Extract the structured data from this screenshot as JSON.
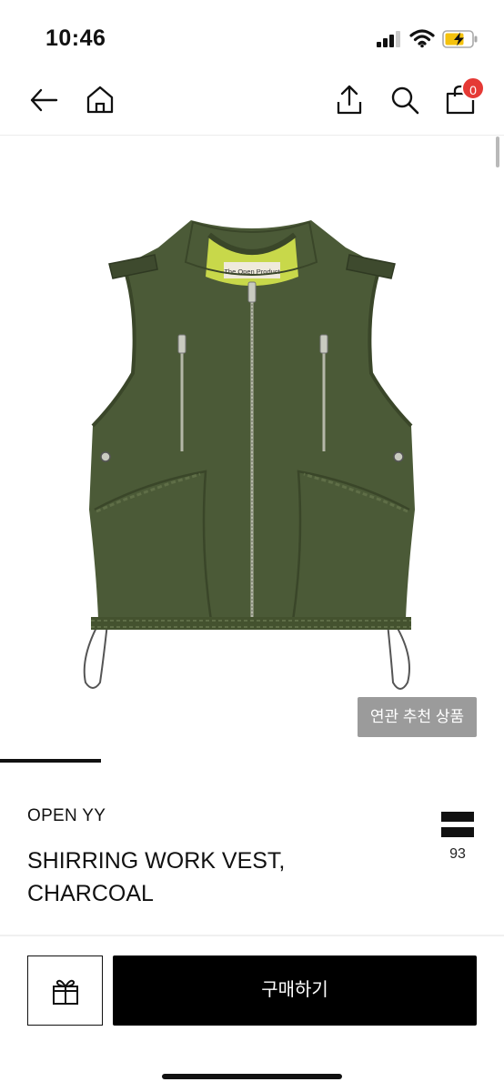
{
  "status_bar": {
    "time": "10:46"
  },
  "nav": {
    "cart_count": "0"
  },
  "product": {
    "image_label": "The Open Product",
    "related_label": "연관 추천 상품",
    "brand": "OPEN YY",
    "title": "SHIRRING WORK VEST, CHARCOAL",
    "size_count": "93"
  },
  "actions": {
    "buy_label": "구매하기"
  },
  "colors": {
    "badge": "#e53935",
    "vest": "#4b5a37",
    "lining": "#c8d84a",
    "related_button": "#9b9b9b",
    "buy_button": "#000000"
  }
}
